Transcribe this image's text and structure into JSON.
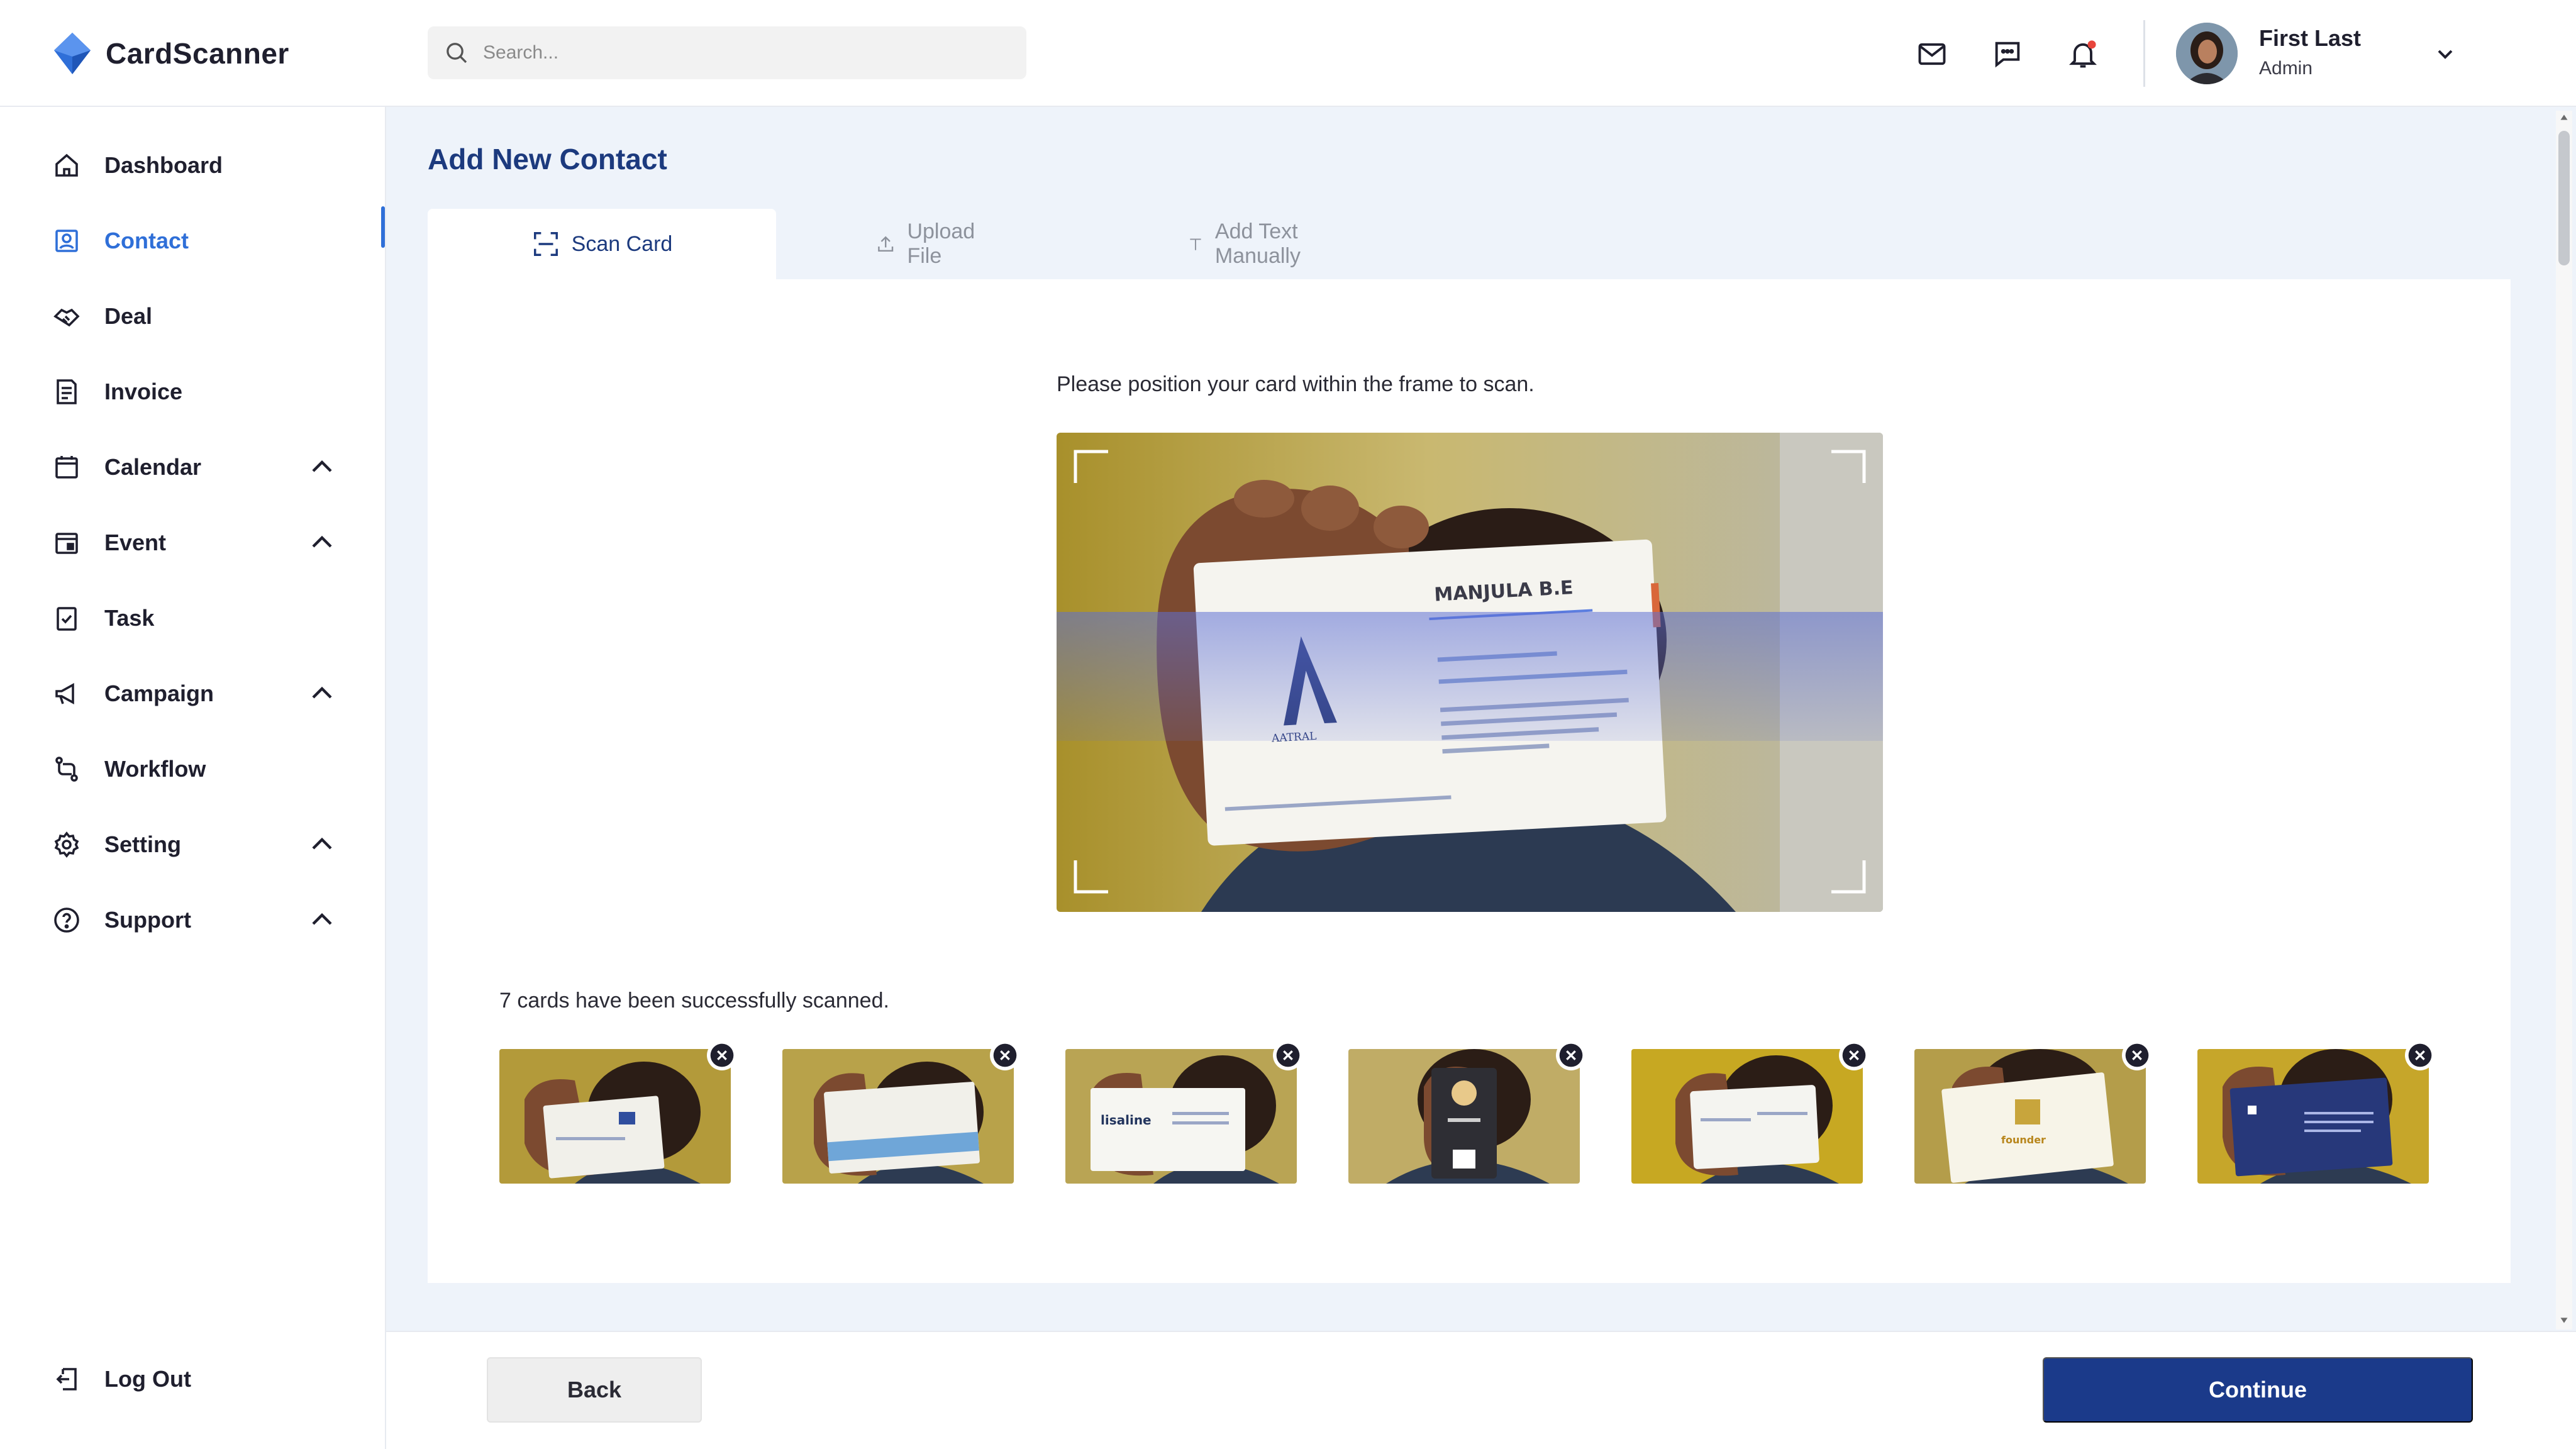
{
  "app": {
    "name": "CardScanner",
    "accent": "#2f6fd8",
    "brand_dark": "#1b3a8a"
  },
  "search": {
    "placeholder": "Search..."
  },
  "header": {
    "icons": [
      "mail-icon",
      "chat-icon",
      "bell-icon"
    ],
    "notification_dot_color": "#e8453c",
    "user": {
      "name": "First Last",
      "role": "Admin"
    }
  },
  "sidebar": {
    "items": [
      {
        "label": "Dashboard",
        "icon": "home-icon",
        "active": false,
        "expandable": false
      },
      {
        "label": "Contact",
        "icon": "contact-icon",
        "active": true,
        "expandable": false
      },
      {
        "label": "Deal",
        "icon": "deal-icon",
        "active": false,
        "expandable": false
      },
      {
        "label": "Invoice",
        "icon": "invoice-icon",
        "active": false,
        "expandable": false
      },
      {
        "label": "Calendar",
        "icon": "calendar-icon",
        "active": false,
        "expandable": true
      },
      {
        "label": "Event",
        "icon": "event-icon",
        "active": false,
        "expandable": true
      },
      {
        "label": "Task",
        "icon": "task-icon",
        "active": false,
        "expandable": false
      },
      {
        "label": "Campaign",
        "icon": "megaphone-icon",
        "active": false,
        "expandable": true
      },
      {
        "label": "Workflow",
        "icon": "workflow-icon",
        "active": false,
        "expandable": false
      },
      {
        "label": "Setting",
        "icon": "gear-icon",
        "active": false,
        "expandable": true
      },
      {
        "label": "Support",
        "icon": "help-icon",
        "active": false,
        "expandable": true
      }
    ],
    "logout_label": "Log Out"
  },
  "main": {
    "title": "Add New Contact",
    "tabs": [
      {
        "label": "Scan Card",
        "icon": "scan-icon",
        "active": true
      },
      {
        "label": "Upload File",
        "icon": "upload-icon",
        "active": false
      },
      {
        "label": "Add Text Manually",
        "icon": "text-icon",
        "active": false
      }
    ],
    "instruction": "Please position your card within the frame to scan.",
    "scanned_summary": "7 cards have been successfully scanned.",
    "scanned_cards_count": 7
  },
  "footer": {
    "back_label": "Back",
    "continue_label": "Continue"
  }
}
